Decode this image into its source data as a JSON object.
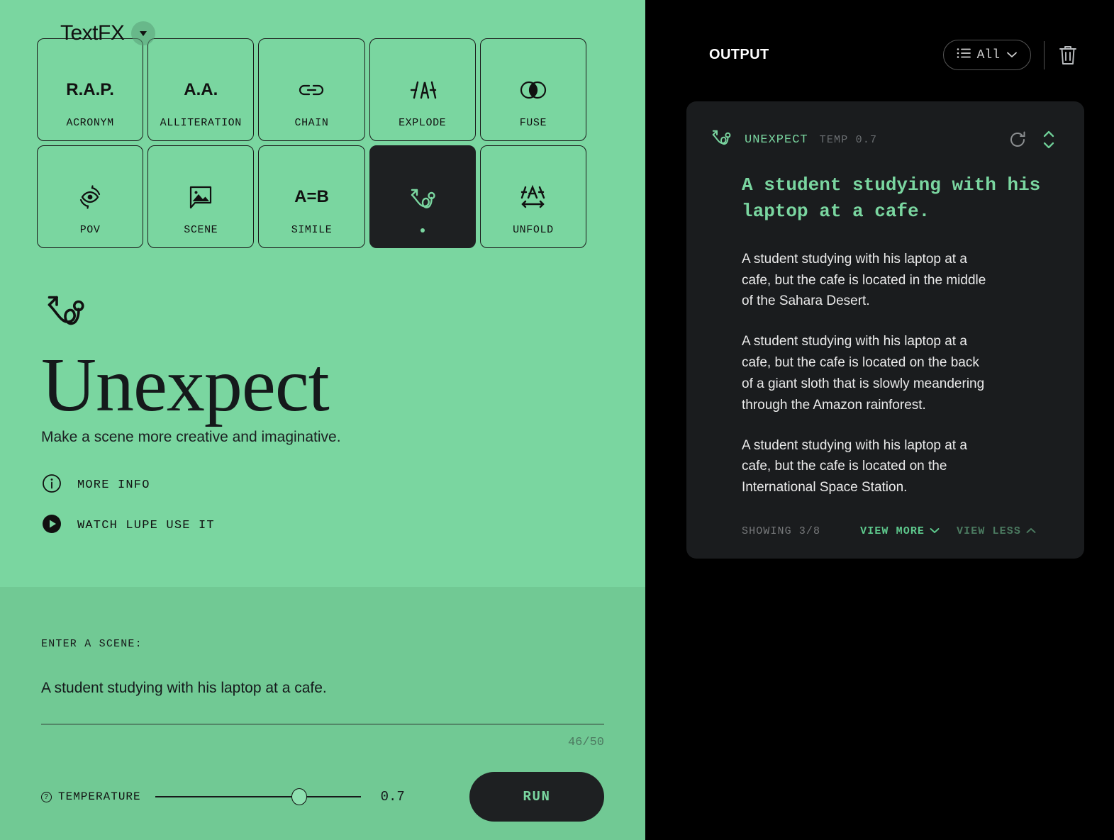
{
  "brand": {
    "name": "TextFX",
    "caret_icon": "chevron-down-icon"
  },
  "tools": [
    {
      "id": "acronym",
      "label": "ACRONYM",
      "icon_text": "R.A.P.",
      "icon": "acronym-icon",
      "selected": false
    },
    {
      "id": "alliteration",
      "label": "ALLITERATION",
      "icon_text": "A.A.",
      "icon": "alliteration-icon",
      "selected": false
    },
    {
      "id": "chain",
      "label": "CHAIN",
      "icon_text": "",
      "icon": "link-icon",
      "selected": false
    },
    {
      "id": "explode",
      "label": "EXPLODE",
      "icon_text": "",
      "icon": "explode-icon",
      "selected": false
    },
    {
      "id": "fuse",
      "label": "FUSE",
      "icon_text": "",
      "icon": "fuse-icon",
      "selected": false
    },
    {
      "id": "pov",
      "label": "POV",
      "icon_text": "",
      "icon": "eye-rotate-icon",
      "selected": false
    },
    {
      "id": "scene",
      "label": "SCENE",
      "icon_text": "",
      "icon": "image-bubble-icon",
      "selected": false
    },
    {
      "id": "simile",
      "label": "SIMILE",
      "icon_text": "A=B",
      "icon": "simile-icon",
      "selected": false
    },
    {
      "id": "unexpect",
      "label": "",
      "icon_text": "",
      "icon": "unexpect-icon",
      "selected": true
    },
    {
      "id": "unfold",
      "label": "UNFOLD",
      "icon_text": "",
      "icon": "unfold-icon",
      "selected": false
    }
  ],
  "hero": {
    "icon": "unexpect-icon",
    "title": "Unexpect",
    "subtitle": "Make a scene more creative and imaginative.",
    "links": [
      {
        "id": "more-info",
        "label": "MORE INFO",
        "icon": "info-icon"
      },
      {
        "id": "watch-lupe",
        "label": "WATCH LUPE USE IT",
        "icon": "play-icon"
      }
    ]
  },
  "input": {
    "label": "ENTER A SCENE:",
    "value": "A student studying with his laptop at a cafe.",
    "placeholder": "A student studying with his laptop at a cafe.",
    "char_count": "46/50"
  },
  "controls": {
    "temperature_label": "TEMPERATURE",
    "temperature_value": "0.7",
    "run_label": "RUN"
  },
  "output": {
    "title": "OUTPUT",
    "filter": {
      "label": "All",
      "icon": "list-icon",
      "caret": "chevron-down-icon"
    },
    "trash_icon": "trash-icon",
    "card": {
      "name": "UNEXPECT",
      "temp": "TEMP 0.7",
      "icon": "unexpect-icon",
      "refresh_icon": "refresh-icon",
      "expand_icon": "expand-collapse-icon",
      "prompt": "A student studying with his laptop at a cafe.",
      "results": [
        "A student studying with his laptop at a cafe, but the cafe is located in the middle of the Sahara Desert.",
        "A student studying with his laptop at a cafe, but the cafe is located on the back of a giant sloth that is slowly meandering through the Amazon rainforest.",
        "A student studying with his laptop at a cafe, but the cafe is located on the International Space Station."
      ],
      "showing": "SHOWING 3/8",
      "view_more": "VIEW MORE",
      "view_less": "VIEW LESS"
    }
  },
  "colors": {
    "green_top": "#7AD6A0",
    "green_bottom": "#71C994",
    "dark": "#1E2022",
    "card_bg": "#1A1C1E",
    "accent_green": "#7AD6A0"
  }
}
